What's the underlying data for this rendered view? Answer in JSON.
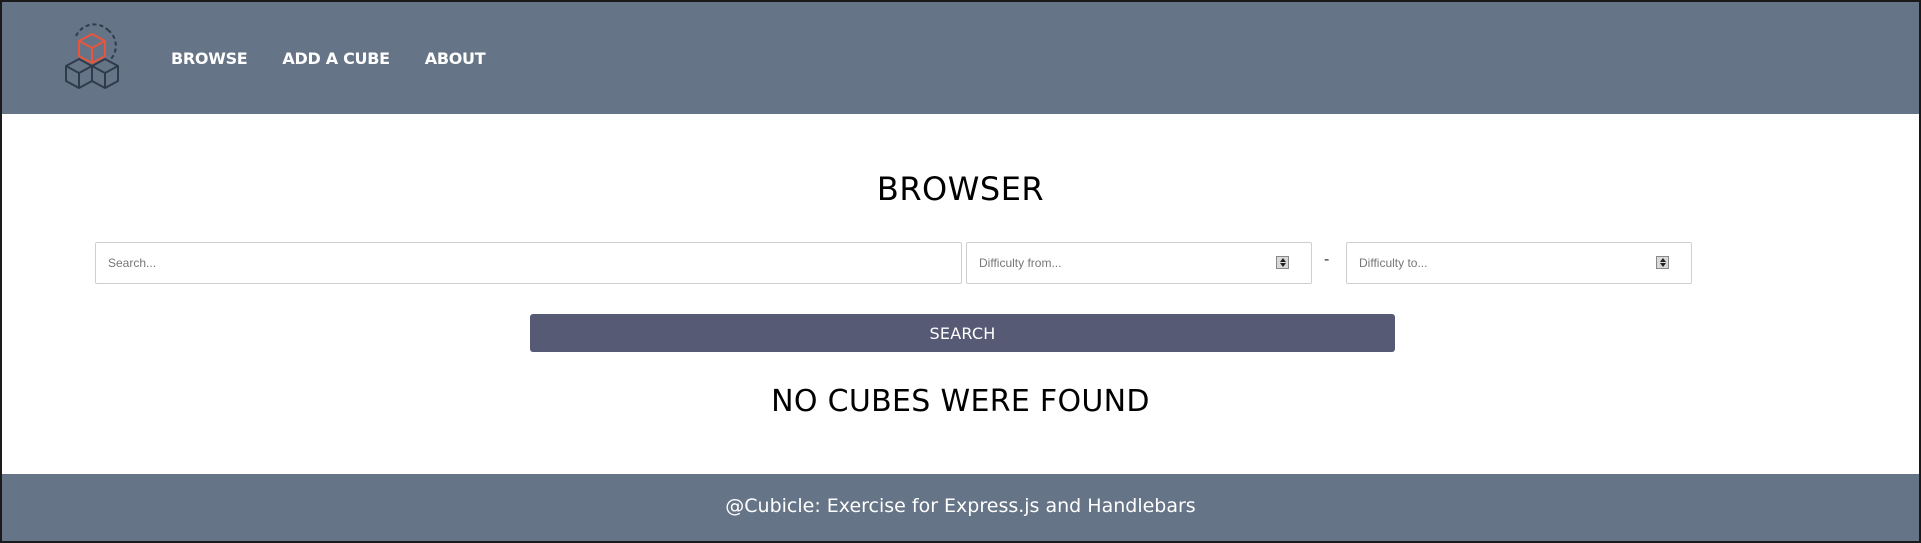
{
  "header": {
    "logo_icon": "cube-stack-logo-icon",
    "nav": [
      {
        "label": "BROWSE"
      },
      {
        "label": "ADD A CUBE"
      },
      {
        "label": "ABOUT"
      }
    ]
  },
  "main": {
    "title": "BROWSER",
    "search": {
      "placeholder": "Search...",
      "value": ""
    },
    "difficulty_from": {
      "placeholder": "Difficulty from...",
      "value": ""
    },
    "separator": "-",
    "difficulty_to": {
      "placeholder": "Difficulty to...",
      "value": ""
    },
    "search_button_label": "SEARCH",
    "empty_message": "NO CUBES WERE FOUND"
  },
  "footer": {
    "text": "@Cubicle: Exercise for Express.js and Handlebars"
  },
  "colors": {
    "header_bg": "#667487",
    "footer_bg": "#667487",
    "button_bg": "#575a74",
    "logo_accent": "#e8553e",
    "logo_dark": "#2f3b4d"
  }
}
